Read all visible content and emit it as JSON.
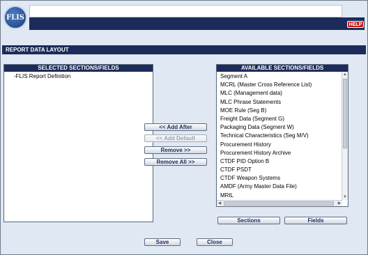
{
  "header": {
    "logo_text": "FLIS",
    "help_label": "HELP"
  },
  "section_title": "REPORT DATA LAYOUT",
  "selected_panel": {
    "title": "SELECTED SECTIONS/FIELDS",
    "items": [
      "-FLIS Report Definition"
    ]
  },
  "available_panel": {
    "title": "AVAILABLE SECTIONS/FIELDS",
    "items": [
      "Segment A",
      "MCRL (Master Cross Reference List)",
      "MLC (Management data)",
      "MLC Phrase Statements",
      "MOE Rule (Seg B)",
      "Freight Data (Segment G)",
      "Packaging Data (Segment W)",
      "Technical Characteristics (Seg M/V)",
      "Procurement History",
      "Procurement History Archive",
      "CTDF PID Option B",
      "CTDF PSDT",
      "CTDF Weapon Systems",
      "AMDF (Army Master Data File)",
      "MRIL"
    ]
  },
  "actions": {
    "add_after": "<< Add After",
    "add_default": "<< Add Default",
    "remove": "Remove >>",
    "remove_all": "Remove All >>"
  },
  "list_buttons": {
    "sections": "Sections",
    "fields": "Fields"
  },
  "footer": {
    "save": "Save",
    "close": "Close"
  }
}
